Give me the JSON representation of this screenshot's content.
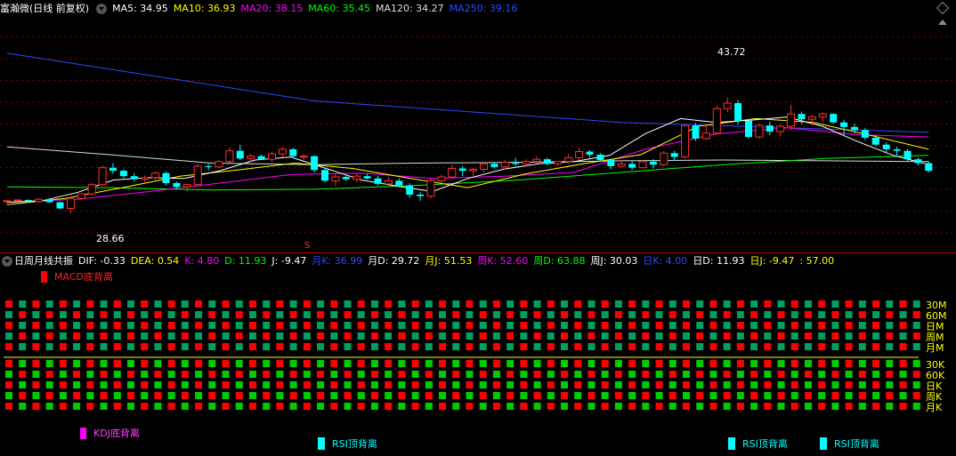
{
  "header": {
    "title": "富瀚微(日线 前复权)",
    "indicators": [
      {
        "label": "MA5: 34.95",
        "color": "#ffffff"
      },
      {
        "label": "MA10: 36.93",
        "color": "#ffff00"
      },
      {
        "label": "MA20: 38.15",
        "color": "#ff00ff"
      },
      {
        "label": "MA60: 35.45",
        "color": "#00ff00"
      },
      {
        "label": "MA120: 34.27",
        "color": "#dddddd"
      },
      {
        "label": "MA250: 39.16",
        "color": "#2a4bff"
      }
    ]
  },
  "price_annotations": {
    "high": "43.72",
    "low": "28.66",
    "marker": "S"
  },
  "sub_header": {
    "title": "日周月线共振",
    "values": [
      {
        "label": "DIF: -0.33",
        "color": "#ffffff"
      },
      {
        "label": "DEA: 0.54",
        "color": "#ffff00"
      },
      {
        "label": "K: 4.80",
        "color": "#ff00ff"
      },
      {
        "label": "D: 11.93",
        "color": "#00ff00"
      },
      {
        "label": "J: -9.47",
        "color": "#ffffff"
      },
      {
        "label": "月K: 36.99",
        "color": "#2a4bff"
      },
      {
        "label": "月D: 29.72",
        "color": "#ffffff"
      },
      {
        "label": "月J: 51.53",
        "color": "#ffff00"
      },
      {
        "label": "周K: 52.60",
        "color": "#ff00ff"
      },
      {
        "label": "周D: 63.88",
        "color": "#00ff00"
      },
      {
        "label": "周J: 30.03",
        "color": "#ffffff"
      },
      {
        "label": "日K: 4.00",
        "color": "#2a4bff"
      },
      {
        "label": "日D: 11.93",
        "color": "#ffffff"
      },
      {
        "label": "日J: -9.47",
        "color": "#ffff00"
      },
      {
        "label": ": 57.00",
        "color": "#ffff00"
      }
    ]
  },
  "signals": {
    "macd": "MACD底背离",
    "kdj": "KDJ底背离",
    "rsi_labels": [
      "RSI顶背离",
      "RSI顶背离",
      "RSI顶背离"
    ]
  },
  "row_labels": [
    "30M",
    "60M",
    "日M",
    "周M",
    "月M",
    "30K",
    "60K",
    "日K",
    "周K",
    "月K"
  ],
  "colors": {
    "up": "#ff3030",
    "down": "#00ffff",
    "green": "#00cc00",
    "teal": "#00a060",
    "red": "#ff0000",
    "label": "#ffff00"
  },
  "candles": [
    [
      30.2,
      30.4,
      29.9,
      30.3
    ],
    [
      30.3,
      30.5,
      30.0,
      30.4
    ],
    [
      30.4,
      30.5,
      30.1,
      30.2
    ],
    [
      30.2,
      30.6,
      30.0,
      30.5
    ],
    [
      30.5,
      30.6,
      30.0,
      30.1
    ],
    [
      30.1,
      30.2,
      29.2,
      29.3
    ],
    [
      29.3,
      30.8,
      28.66,
      30.6
    ],
    [
      30.6,
      31.3,
      30.4,
      31.2
    ],
    [
      31.2,
      32.6,
      31.0,
      32.4
    ],
    [
      32.4,
      34.9,
      32.2,
      34.6
    ],
    [
      34.6,
      35.2,
      33.8,
      34.2
    ],
    [
      34.2,
      34.4,
      33.2,
      33.5
    ],
    [
      33.5,
      33.9,
      32.8,
      33.1
    ],
    [
      33.1,
      33.6,
      32.7,
      33.3
    ],
    [
      33.3,
      34.1,
      33.0,
      33.9
    ],
    [
      33.9,
      34.1,
      32.3,
      32.6
    ],
    [
      32.6,
      32.8,
      31.8,
      32.1
    ],
    [
      32.1,
      32.5,
      31.5,
      32.4
    ],
    [
      32.4,
      35.1,
      32.2,
      34.8
    ],
    [
      34.8,
      35.1,
      34.3,
      34.7
    ],
    [
      34.7,
      35.6,
      34.5,
      35.4
    ],
    [
      35.4,
      37.2,
      35.2,
      36.8
    ],
    [
      36.8,
      37.6,
      35.6,
      35.8
    ],
    [
      35.8,
      36.4,
      35.4,
      36.1
    ],
    [
      36.1,
      36.3,
      35.6,
      35.7
    ],
    [
      35.7,
      36.7,
      35.3,
      36.4
    ],
    [
      36.4,
      37.3,
      36.0,
      37.0
    ],
    [
      37.0,
      37.2,
      35.9,
      36.1
    ],
    [
      36.1,
      36.4,
      35.6,
      36.1
    ],
    [
      36.1,
      36.2,
      34.0,
      34.3
    ],
    [
      34.3,
      34.6,
      32.7,
      32.9
    ],
    [
      32.9,
      33.8,
      32.2,
      33.4
    ],
    [
      33.4,
      33.6,
      32.9,
      33.1
    ],
    [
      33.1,
      33.8,
      32.7,
      33.5
    ],
    [
      33.5,
      33.8,
      33.1,
      33.2
    ],
    [
      33.2,
      33.5,
      32.3,
      32.5
    ],
    [
      32.5,
      33.4,
      32.3,
      32.9
    ],
    [
      32.9,
      33.2,
      32.1,
      32.3
    ],
    [
      32.3,
      32.6,
      30.7,
      31.1
    ],
    [
      31.1,
      31.4,
      30.3,
      30.9
    ],
    [
      30.9,
      33.2,
      30.6,
      32.9
    ],
    [
      32.9,
      33.7,
      32.6,
      33.4
    ],
    [
      33.4,
      35.0,
      33.2,
      34.5
    ],
    [
      34.5,
      34.8,
      33.5,
      34.2
    ],
    [
      34.2,
      34.6,
      33.4,
      34.4
    ],
    [
      34.4,
      35.3,
      34.0,
      35.1
    ],
    [
      35.1,
      35.3,
      34.5,
      34.7
    ],
    [
      34.7,
      35.6,
      34.4,
      35.3
    ],
    [
      35.3,
      35.9,
      34.8,
      35.1
    ],
    [
      35.1,
      35.7,
      34.8,
      35.4
    ],
    [
      35.4,
      36.1,
      35.2,
      35.7
    ],
    [
      35.7,
      35.9,
      34.9,
      35.1
    ],
    [
      35.1,
      35.5,
      34.8,
      35.4
    ],
    [
      35.4,
      36.4,
      35.2,
      35.9
    ],
    [
      35.9,
      37.2,
      35.6,
      36.7
    ],
    [
      36.7,
      36.9,
      35.9,
      36.3
    ],
    [
      36.3,
      36.5,
      35.4,
      35.6
    ],
    [
      35.6,
      35.8,
      34.4,
      34.8
    ],
    [
      34.8,
      35.6,
      34.6,
      35.1
    ],
    [
      35.1,
      35.5,
      34.3,
      34.6
    ],
    [
      34.6,
      35.6,
      34.5,
      35.4
    ],
    [
      35.4,
      35.7,
      34.5,
      35.0
    ],
    [
      35.0,
      36.8,
      34.8,
      36.5
    ],
    [
      36.5,
      36.8,
      35.5,
      36.0
    ],
    [
      36.0,
      39.3,
      35.8,
      40.1
    ],
    [
      40.1,
      40.4,
      38.1,
      38.4
    ],
    [
      38.4,
      40.3,
      38.2,
      39.1
    ],
    [
      39.1,
      42.7,
      38.9,
      42.3
    ],
    [
      42.3,
      43.72,
      41.8,
      43.0
    ],
    [
      43.0,
      43.4,
      40.2,
      40.7
    ],
    [
      40.7,
      40.9,
      38.4,
      38.6
    ],
    [
      38.6,
      40.3,
      38.4,
      40.1
    ],
    [
      40.1,
      40.6,
      38.8,
      39.3
    ],
    [
      39.3,
      40.2,
      38.7,
      40.0
    ],
    [
      40.0,
      42.8,
      39.5,
      41.6
    ],
    [
      41.6,
      41.9,
      40.3,
      40.9
    ],
    [
      40.9,
      41.5,
      40.1,
      41.2
    ],
    [
      41.2,
      41.8,
      40.5,
      41.6
    ],
    [
      41.6,
      41.7,
      40.3,
      40.5
    ],
    [
      40.5,
      40.8,
      38.8,
      39.9
    ],
    [
      39.9,
      40.3,
      39.1,
      39.5
    ],
    [
      39.5,
      39.8,
      38.2,
      38.5
    ],
    [
      38.5,
      38.9,
      37.4,
      37.6
    ],
    [
      37.6,
      37.9,
      36.6,
      37.0
    ],
    [
      37.0,
      37.3,
      36.2,
      36.8
    ],
    [
      36.8,
      37.0,
      35.5,
      35.7
    ],
    [
      35.7,
      35.9,
      34.9,
      35.2
    ],
    [
      35.2,
      35.4,
      34.0,
      34.2
    ]
  ],
  "ma_lines": {
    "ma250": [
      49.5,
      43.3,
      40.5,
      39.2
    ],
    "ma120": [
      37.3,
      36.3,
      35.2,
      35.0,
      35.2,
      35.3,
      35.5,
      35.6,
      35.5,
      35.4
    ],
    "ma60": [
      32.1,
      32.0,
      31.7,
      31.8,
      32.3,
      33.0,
      34.0,
      35.0,
      35.8,
      36.2
    ],
    "ma20": [
      30.1,
      30.5,
      31.5,
      32.6,
      33.7,
      33.9,
      33.2,
      33.5,
      34.0,
      37.0,
      39.0,
      39.8,
      38.9,
      38.6
    ],
    "ma10": [
      29.8,
      30.6,
      32.0,
      33.5,
      34.3,
      35.2,
      34.5,
      33.2,
      32.0,
      33.8,
      35.1,
      36.3,
      40.0,
      41.0,
      40.5,
      38.8,
      37.0
    ],
    "ma5": [
      30.1,
      30.3,
      31.4,
      33.0,
      33.3,
      33.2,
      34.2,
      35.6,
      36.0,
      34.5,
      33.0,
      32.2,
      31.5,
      33.2,
      34.4,
      35.1,
      35.4,
      36.2,
      39.0,
      41.0,
      40.5,
      40.8,
      41.2,
      40.0,
      38.0,
      36.2,
      35.0
    ]
  },
  "grid": {
    "cols": 68,
    "rows": [
      {
        "c1": "red",
        "c2": "teal",
        "start": "red"
      },
      {
        "c1": "red",
        "c2": "teal",
        "start": "teal"
      },
      {
        "c1": "red",
        "c2": "teal",
        "start": "red"
      },
      {
        "c1": "red",
        "c2": "teal",
        "start": "teal"
      },
      {
        "c1": "red",
        "c2": "teal",
        "start": "red"
      },
      {
        "c1": "red",
        "c2": "green",
        "start": "red"
      },
      {
        "c1": "red",
        "c2": "green",
        "start": "green"
      },
      {
        "c1": "red",
        "c2": "green",
        "start": "red"
      },
      {
        "c1": "red",
        "c2": "green",
        "start": "green"
      },
      {
        "c1": "red",
        "c2": "green",
        "start": "red"
      }
    ]
  }
}
